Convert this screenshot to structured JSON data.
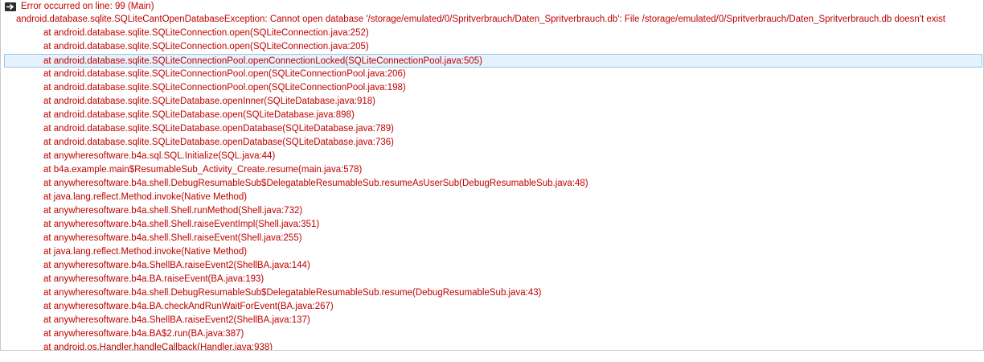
{
  "header": {
    "icon": "arrow-right-icon",
    "text": "Error occurred on line: 99 (Main)"
  },
  "exception": "android.database.sqlite.SQLiteCantOpenDatabaseException: Cannot open database '/storage/emulated/0/Spritverbrauch/Daten_Spritverbrauch.db': File /storage/emulated/0/Spritverbrauch/Daten_Spritverbrauch.db doesn't exist",
  "trace": [
    "at android.database.sqlite.SQLiteConnection.open(SQLiteConnection.java:252)",
    "at android.database.sqlite.SQLiteConnection.open(SQLiteConnection.java:205)",
    "at android.database.sqlite.SQLiteConnectionPool.openConnectionLocked(SQLiteConnectionPool.java:505)",
    "at android.database.sqlite.SQLiteConnectionPool.open(SQLiteConnectionPool.java:206)",
    "at android.database.sqlite.SQLiteConnectionPool.open(SQLiteConnectionPool.java:198)",
    "at android.database.sqlite.SQLiteDatabase.openInner(SQLiteDatabase.java:918)",
    "at android.database.sqlite.SQLiteDatabase.open(SQLiteDatabase.java:898)",
    "at android.database.sqlite.SQLiteDatabase.openDatabase(SQLiteDatabase.java:789)",
    "at android.database.sqlite.SQLiteDatabase.openDatabase(SQLiteDatabase.java:736)",
    "at anywheresoftware.b4a.sql.SQL.Initialize(SQL.java:44)",
    "at b4a.example.main$ResumableSub_Activity_Create.resume(main.java:578)",
    "at anywheresoftware.b4a.shell.DebugResumableSub$DelegatableResumableSub.resumeAsUserSub(DebugResumableSub.java:48)",
    "at java.lang.reflect.Method.invoke(Native Method)",
    "at anywheresoftware.b4a.shell.Shell.runMethod(Shell.java:732)",
    "at anywheresoftware.b4a.shell.Shell.raiseEventImpl(Shell.java:351)",
    "at anywheresoftware.b4a.shell.Shell.raiseEvent(Shell.java:255)",
    "at java.lang.reflect.Method.invoke(Native Method)",
    "at anywheresoftware.b4a.ShellBA.raiseEvent2(ShellBA.java:144)",
    "at anywheresoftware.b4a.BA.raiseEvent(BA.java:193)",
    "at anywheresoftware.b4a.shell.DebugResumableSub$DelegatableResumableSub.resume(DebugResumableSub.java:43)",
    "at anywheresoftware.b4a.BA.checkAndRunWaitForEvent(BA.java:267)",
    "at anywheresoftware.b4a.ShellBA.raiseEvent2(ShellBA.java:137)",
    "at anywheresoftware.b4a.BA$2.run(BA.java:387)",
    "at android.os.Handler.handleCallback(Handler.java:938)"
  ],
  "selected_index": 2,
  "colors": {
    "error_text": "#c00000",
    "selection_bg": "#e5f1fb",
    "selection_border": "#99c9ef"
  }
}
